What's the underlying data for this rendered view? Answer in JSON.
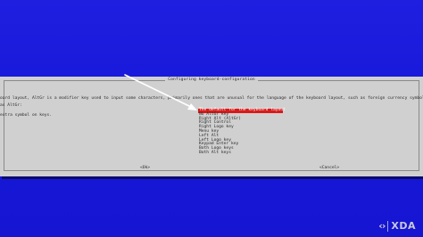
{
  "dialog": {
    "title": "Configuring keyboard-configuration",
    "description_line1": "oard layout, AltGr is a modifier key used to input some characters, primarily ones that are unusual for the language of the keyboard layout, such as foreign currency symbols and",
    "description_line2": "extra symbol on keys.",
    "prompt": "as AltGr:",
    "options": [
      "The default for the keyboard layout",
      "No AltGr key",
      "Right Alt (AltGr)",
      "Right Control",
      "Right Logo key",
      "Menu key",
      "Left Alt",
      "Left Logo key",
      "Keypad Enter key",
      "Both Logo keys",
      "Both Alt keys"
    ],
    "selected_index": 0,
    "ok_label": "<Ok>",
    "cancel_label": "<Cancel>"
  },
  "watermark": {
    "brand": "XDA",
    "logo_icon": "xda-logo-icon"
  },
  "colors": {
    "background": "#1a1ae6",
    "dialog": "#d0d0d0",
    "selection": "#d91a1a",
    "arrow": "#ffffff"
  }
}
